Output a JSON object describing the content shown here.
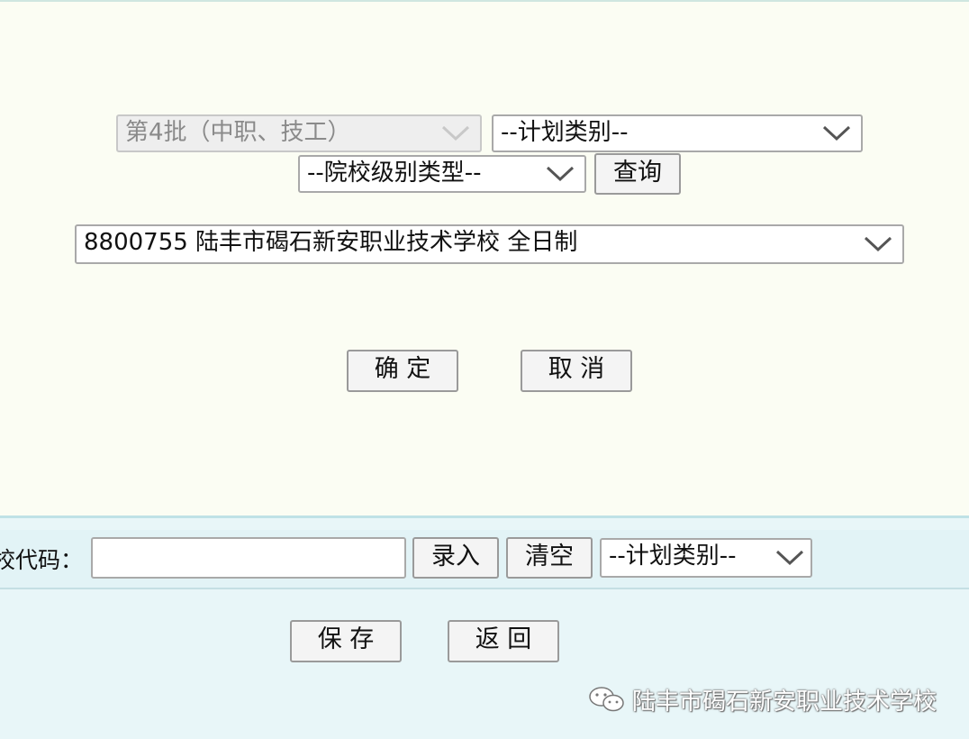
{
  "form": {
    "batch_select": "第4批（中职、技工）",
    "plan_type_select": "--计划类别--",
    "school_level_select": "--院校级别类型--",
    "query_button": "查询",
    "school_select": "8800755 陆丰市碣石新安职业技术学校 全日制",
    "confirm_button": "确 定",
    "cancel_button": "取 消"
  },
  "bottom": {
    "school_code_label": "校代码：",
    "school_code_value": "",
    "enter_button": "录入",
    "clear_button": "清空",
    "plan_type_select": "--计划类别--",
    "save_button": "保 存",
    "back_button": "返 回"
  },
  "watermark": {
    "text": "陆丰市碣石新安职业技术学校",
    "icon": "wechat-icon"
  },
  "colors": {
    "dialog_bg": "#fbfdf3",
    "bottom_bg": "#e8f6f8",
    "disabled_bg": "#eeeeee"
  }
}
